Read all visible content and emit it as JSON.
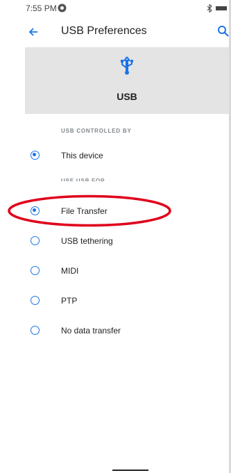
{
  "status_bar": {
    "time": "7:55 PM",
    "icons": [
      "app-notification-icon",
      "bluetooth-icon",
      "battery-icon"
    ]
  },
  "app_bar": {
    "title": "USB Preferences",
    "back_icon": "arrow-left-icon",
    "search_icon": "search-icon"
  },
  "header": {
    "icon": "usb-icon",
    "title": "USB"
  },
  "controlled_by": {
    "label": "USB CONTROLLED BY",
    "options": [
      {
        "label": "This device",
        "checked": true
      }
    ]
  },
  "use_for": {
    "label": "USE USB FOR",
    "options": [
      {
        "label": "File Transfer",
        "checked": true
      },
      {
        "label": "USB tethering",
        "checked": false
      },
      {
        "label": "MIDI",
        "checked": false
      },
      {
        "label": "PTP",
        "checked": false
      },
      {
        "label": "No data transfer",
        "checked": false
      }
    ]
  },
  "colors": {
    "accent": "#1a73e8",
    "header_bg": "#e4e4e4",
    "annotation": "#e0001b"
  }
}
